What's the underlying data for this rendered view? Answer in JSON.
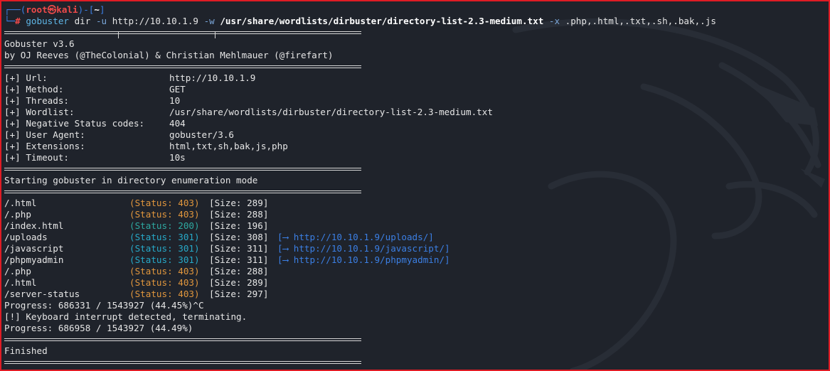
{
  "prompt": {
    "open": "┌──(",
    "user": "root㉿kali",
    "mid": ")-[",
    "cwd": "~",
    "close": "]",
    "line2": "└─",
    "hash": "# "
  },
  "command": {
    "bin": "gobuster",
    "sub": " dir ",
    "flag_u": "-u",
    "url": " http://10.10.1.9 ",
    "flag_w": "-w",
    "wordlist": " /usr/share/wordlists/dirbuster/directory-list-2.3-medium.txt ",
    "flag_x": "-x",
    "exts": " .php,.html,.txt,.sh,.bak,.js"
  },
  "banner": {
    "version": "Gobuster v3.6",
    "authors": "by OJ Reeves (@TheColonial) & Christian Mehlmauer (@firefart)"
  },
  "config": [
    {
      "key": "[+] Url:",
      "value": "http://10.10.1.9"
    },
    {
      "key": "[+] Method:",
      "value": "GET"
    },
    {
      "key": "[+] Threads:",
      "value": "10"
    },
    {
      "key": "[+] Wordlist:",
      "value": "/usr/share/wordlists/dirbuster/directory-list-2.3-medium.txt"
    },
    {
      "key": "[+] Negative Status codes:",
      "value": "404"
    },
    {
      "key": "[+] User Agent:",
      "value": "gobuster/3.6"
    },
    {
      "key": "[+] Extensions:",
      "value": "html,txt,sh,bak,js,php"
    },
    {
      "key": "[+] Timeout:",
      "value": "10s"
    }
  ],
  "start_msg": "Starting gobuster in directory enumeration mode",
  "results": [
    {
      "path": "/.html",
      "status": "(Status: 403)",
      "size": "[Size: 289]",
      "redirect": "",
      "color": "#e0963d"
    },
    {
      "path": "/.php",
      "status": "(Status: 403)",
      "size": "[Size: 288]",
      "redirect": "",
      "color": "#e0963d"
    },
    {
      "path": "/index.html",
      "status": "(Status: 200)",
      "size": "[Size: 196]",
      "redirect": "",
      "color": "#2ea8a0"
    },
    {
      "path": "/uploads",
      "status": "(Status: 301)",
      "size": "[Size: 308]",
      "redirect": "[⟶ http://10.10.1.9/uploads/]",
      "color": "#27a9c8"
    },
    {
      "path": "/javascript",
      "status": "(Status: 301)",
      "size": "[Size: 311]",
      "redirect": "[⟶ http://10.10.1.9/javascript/]",
      "color": "#27a9c8"
    },
    {
      "path": "/phpmyadmin",
      "status": "(Status: 301)",
      "size": "[Size: 311]",
      "redirect": "[⟶ http://10.10.1.9/phpmyadmin/]",
      "color": "#27a9c8"
    },
    {
      "path": "/.php",
      "status": "(Status: 403)",
      "size": "[Size: 288]",
      "redirect": "",
      "color": "#e0963d"
    },
    {
      "path": "/.html",
      "status": "(Status: 403)",
      "size": "[Size: 289]",
      "redirect": "",
      "color": "#e0963d"
    },
    {
      "path": "/server-status",
      "status": "(Status: 403)",
      "size": "[Size: 297]",
      "redirect": "",
      "color": "#e0963d"
    }
  ],
  "progress1": "Progress: 686331 / 1543927 (44.45%)^C",
  "interrupt": "[!] Keyboard interrupt detected, terminating.",
  "progress2": "Progress: 686958 / 1543927 (44.49%)",
  "finished": "Finished"
}
